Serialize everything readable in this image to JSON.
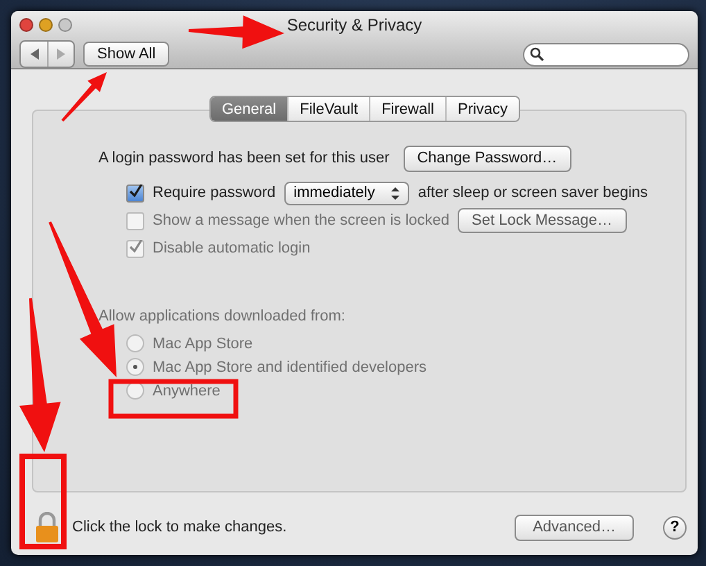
{
  "window": {
    "title": "Security & Privacy"
  },
  "toolbar": {
    "show_all": "Show All"
  },
  "tabs": [
    {
      "label": "General",
      "selected": true
    },
    {
      "label": "FileVault",
      "selected": false
    },
    {
      "label": "Firewall",
      "selected": false
    },
    {
      "label": "Privacy",
      "selected": false
    }
  ],
  "password": {
    "status": "A login password has been set for this user",
    "change_button": "Change Password…"
  },
  "options": [
    {
      "kind": "popup",
      "label": "Require password",
      "checked": true,
      "disabled": false,
      "popup": "immediately",
      "suffix": "after sleep or screen saver begins"
    },
    {
      "kind": "button",
      "label": "Show a message when the screen is locked",
      "checked": false,
      "disabled": true,
      "button": "Set Lock Message…"
    },
    {
      "kind": "plain",
      "label": "Disable automatic login",
      "checked": true,
      "disabled": true
    }
  ],
  "downloads": {
    "heading": "Allow applications downloaded from:",
    "choices": [
      {
        "label": "Mac App Store",
        "selected": false,
        "disabled": true
      },
      {
        "label": "Mac App Store and identified developers",
        "selected": true,
        "disabled": true
      },
      {
        "label": "Anywhere",
        "selected": false,
        "disabled": true
      }
    ]
  },
  "footer": {
    "lock_text": "Click the lock to make changes.",
    "advanced_button": "Advanced…",
    "help": "?"
  }
}
